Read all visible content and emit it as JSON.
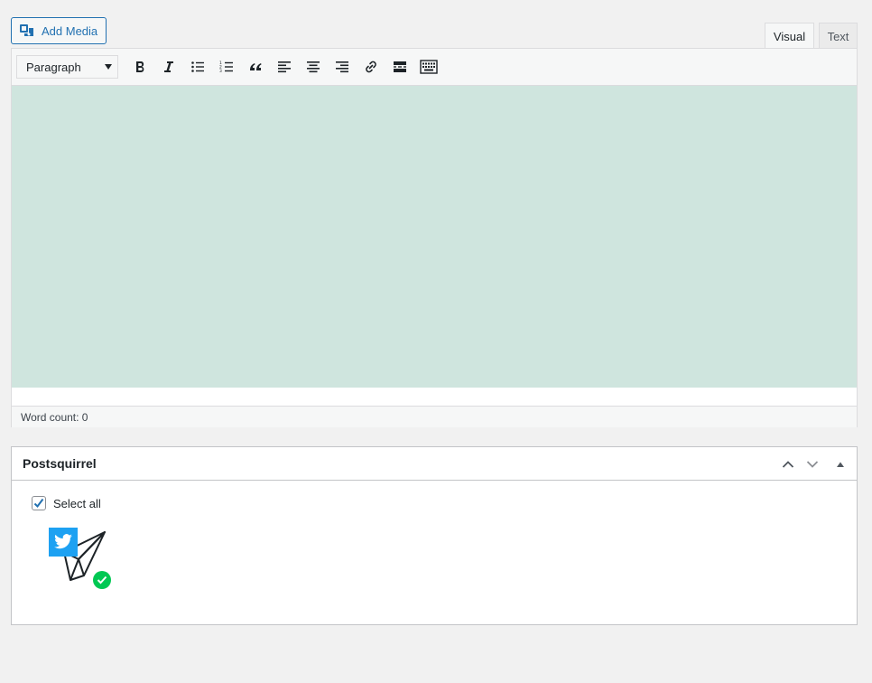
{
  "toolbar": {
    "add_media_label": "Add Media",
    "format_value": "Paragraph",
    "buttons": [
      "bold-button",
      "italic-button",
      "bulleted-list-button",
      "numbered-list-button",
      "blockquote-button",
      "align-left-button",
      "align-center-button",
      "align-right-button",
      "insert-link-button",
      "read-more-button",
      "toolbar-toggle-button"
    ]
  },
  "tabs": {
    "visual": "Visual",
    "text": "Text"
  },
  "editor": {
    "word_count": "Word count: 0",
    "content_bg": "#cfe5de"
  },
  "postbox": {
    "title": "Postsquirrel",
    "select_all_label": "Select all",
    "select_all_checked": true,
    "service_icon": "twitter-icon"
  },
  "colors": {
    "accent": "#2271b1",
    "twitter": "#1da1f2",
    "success": "#00c853"
  }
}
